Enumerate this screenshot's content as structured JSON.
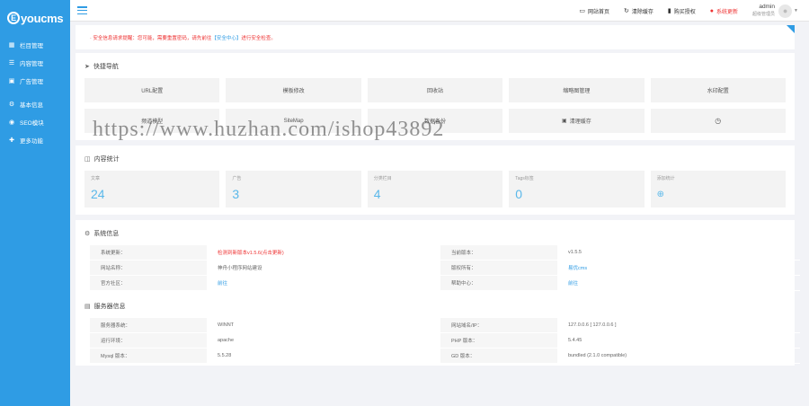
{
  "brand": {
    "logo_letter": "E",
    "logo_text": "youcms"
  },
  "sidebar": {
    "items": [
      {
        "icon": "grid-icon",
        "label": "栏目管理"
      },
      {
        "icon": "list-icon",
        "label": "内容管理"
      },
      {
        "icon": "image-icon",
        "label": "广告管理"
      },
      {
        "icon": "gear-icon",
        "label": "基本信息"
      },
      {
        "icon": "seo-icon",
        "label": "SEO模块"
      },
      {
        "icon": "puzzle-icon",
        "label": "更多功能"
      }
    ]
  },
  "topbar": {
    "site_home": "网站首页",
    "clear_cache": "清除缓存",
    "buy_license": "购买授权",
    "system_update": "系统更新",
    "admin_name": "admin",
    "admin_role": "超级管理员"
  },
  "notice": {
    "text_before": "· 安全信息请求提醒：您可能，需要重置密码，请先前往",
    "link": "【安全中心】",
    "text_after": "进行安全检查。"
  },
  "quick_nav": {
    "title": "快捷导航",
    "items": [
      "URL配置",
      "模板修改",
      "回收站",
      "缩略图管理",
      "水印配置",
      "频道模型",
      "SiteMap",
      "数据备份",
      "清理缓存",
      ""
    ]
  },
  "content_stats": {
    "title": "内容统计",
    "items": [
      {
        "label": "文章",
        "value": "24"
      },
      {
        "label": "广告",
        "value": "3"
      },
      {
        "label": "分类栏目",
        "value": "4"
      },
      {
        "label": "Tags标签",
        "value": "0"
      },
      {
        "label": "添加统计",
        "value": "⊕"
      }
    ]
  },
  "system_info": {
    "title": "系统信息",
    "rows": [
      [
        "系统更新：",
        "检测到新版本v1.5.6(点击更新)",
        "当前版本：",
        "v1.5.5"
      ],
      [
        "网站名称：",
        "神舟小程序网站建设",
        "版权所有：",
        "易优cms"
      ],
      [
        "官方社区：",
        "前往",
        "帮助中心：",
        "前往"
      ]
    ]
  },
  "server_info": {
    "title": "服务器信息",
    "rows": [
      [
        "服务器系统：",
        "WINNT",
        "网站域名/IP：",
        "127.0.0.6 [ 127.0.0.6 ]"
      ],
      [
        "运行环境：",
        "apache",
        "PHP 版本：",
        "5.4.45"
      ],
      [
        "Mysql 版本：",
        "5.5.28",
        "GD 版本：",
        "bundled (2.1.0 compatible)"
      ]
    ]
  },
  "watermark": "https://www.huzhan.com/ishop43892",
  "colors": {
    "accent": "#2f9ce4",
    "alert": "#e33333",
    "stat_value": "#5ab8ea"
  }
}
